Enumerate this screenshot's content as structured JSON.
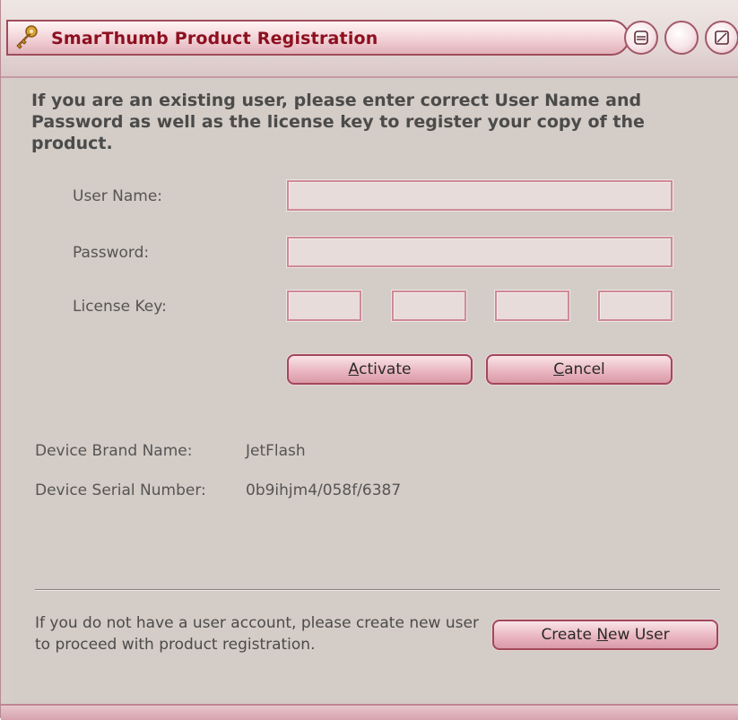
{
  "window": {
    "title": "SmarThumb Product Registration",
    "icon": "key-icon",
    "controls": [
      "minimize-icon",
      "maximize-icon",
      "restore-icon"
    ]
  },
  "intro_text": "If you are an existing user, please enter correct User Name and Password as well as the license key to register your copy of the product.",
  "form": {
    "username_label": "User Name:",
    "username_value": "",
    "password_label": "Password:",
    "password_value": "",
    "license_label": "License Key:",
    "license_parts": [
      "",
      "",
      "",
      ""
    ]
  },
  "buttons": {
    "activate_prefix": "",
    "activate_underlined": "A",
    "activate_rest": "ctivate",
    "cancel_prefix": "",
    "cancel_underlined": "C",
    "cancel_rest": "ancel",
    "create_prefix": "Create ",
    "create_underlined": "N",
    "create_rest": "ew User"
  },
  "device": {
    "brand_label": "Device Brand Name:",
    "brand_value": "JetFlash",
    "serial_label": "Device Serial Number:",
    "serial_value": "0b9ihjm4/058f/6387"
  },
  "footer_text": "If you do not have a user account, please create new user to proceed with product registration.",
  "colors": {
    "title_text": "#8d1020",
    "window_bg": "#d4ccc6",
    "field_border": "#cf8b97",
    "button_fill": "#eab7c1"
  }
}
